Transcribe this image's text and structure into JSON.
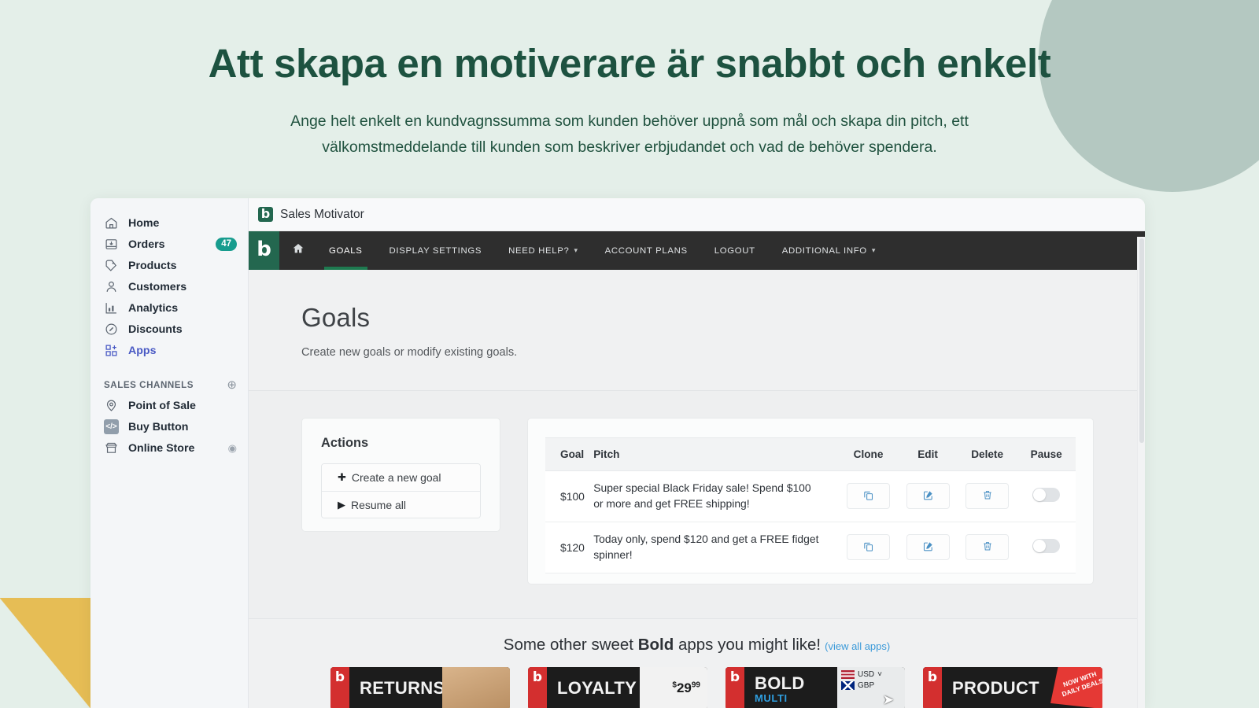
{
  "hero": {
    "title": "Att skapa en motiverare är snabbt och enkelt",
    "subtitle": "Ange helt enkelt en kundvagnssumma som kunden behöver uppnå som mål och skapa din pitch, ett välkomstmeddelande till kunden som beskriver erbjudandet och vad de behöver spendera."
  },
  "colors": {
    "page_bg": "#e4efe9",
    "deco_circle": "#b4c8c1",
    "deco_triangle": "#e6bd55",
    "heading": "#1d5240",
    "brand_green": "#23674f",
    "nav_dark": "#2e2e2e",
    "active_underline": "#1e7a50",
    "badge_teal": "#179c8e",
    "apps_link_blue": "#4959c4",
    "icon_blue": "#4a90c4",
    "promo_link": "#3b9ad9"
  },
  "sidebar": {
    "items": [
      {
        "label": "Home",
        "icon": "home-icon",
        "badge": "",
        "trailing": ""
      },
      {
        "label": "Orders",
        "icon": "orders-inbox-icon",
        "badge": "47",
        "trailing": ""
      },
      {
        "label": "Products",
        "icon": "product-tag-icon",
        "badge": "",
        "trailing": ""
      },
      {
        "label": "Customers",
        "icon": "customer-person-icon",
        "badge": "",
        "trailing": ""
      },
      {
        "label": "Analytics",
        "icon": "analytics-bars-icon",
        "badge": "",
        "trailing": ""
      },
      {
        "label": "Discounts",
        "icon": "discount-percent-icon",
        "badge": "",
        "trailing": ""
      },
      {
        "label": "Apps",
        "icon": "apps-grid-plus-icon",
        "badge": "",
        "trailing": "",
        "active": true
      }
    ],
    "section": {
      "label": "SALES CHANNELS",
      "add_icon": "plus-circle-icon"
    },
    "channels": [
      {
        "label": "Point of Sale",
        "icon": "location-pin-icon",
        "trailing": ""
      },
      {
        "label": "Buy Button",
        "icon": "code-embed-icon",
        "trailing": ""
      },
      {
        "label": "Online Store",
        "icon": "storefront-icon",
        "trailing": "view-eye-icon"
      }
    ]
  },
  "app": {
    "titlebar": {
      "logo": "bold-b-logo",
      "title": "Sales Motivator"
    },
    "nav": {
      "logo": "bold-b-logo",
      "items": [
        {
          "label": "",
          "icon": "home-icon",
          "caret": false,
          "active": false
        },
        {
          "label": "GOALS",
          "icon": "",
          "caret": false,
          "active": true
        },
        {
          "label": "DISPLAY SETTINGS",
          "icon": "",
          "caret": false,
          "active": false
        },
        {
          "label": "NEED HELP?",
          "icon": "",
          "caret": true,
          "active": false
        },
        {
          "label": "ACCOUNT PLANS",
          "icon": "",
          "caret": false,
          "active": false
        },
        {
          "label": "LOGOUT",
          "icon": "",
          "caret": false,
          "active": false
        },
        {
          "label": "ADDITIONAL INFO",
          "icon": "",
          "caret": true,
          "active": false
        }
      ]
    },
    "page": {
      "title": "Goals",
      "subtitle": "Create new goals or modify existing goals."
    },
    "actions": {
      "title": "Actions",
      "items": [
        {
          "label": "Create a new goal",
          "glyph": "✚",
          "icon": "plus-icon"
        },
        {
          "label": "Resume all",
          "glyph": "▶",
          "icon": "play-icon"
        }
      ]
    },
    "table": {
      "columns": [
        "Goal",
        "Pitch",
        "Clone",
        "Edit",
        "Delete",
        "Pause"
      ],
      "rows": [
        {
          "goal": "$100",
          "pitch": "Super special Black Friday sale! Spend $100 or more and get FREE shipping!",
          "clone_icon": "copy-icon",
          "edit_icon": "pencil-square-icon",
          "delete_icon": "trash-icon",
          "pause_state": "off"
        },
        {
          "goal": "$120",
          "pitch": "Today only, spend $120 and get a FREE fidget spinner!",
          "clone_icon": "copy-icon",
          "edit_icon": "pencil-square-icon",
          "delete_icon": "trash-icon",
          "pause_state": "off"
        }
      ]
    },
    "promo": {
      "heading_before": "Some other sweet ",
      "heading_bold": "Bold",
      "heading_after": " apps you might like!",
      "link": "(view all apps)",
      "cards": [
        {
          "word": "RETURNS",
          "sub": "",
          "art": "box-image",
          "price": "",
          "badge": ""
        },
        {
          "word": "LOYALTY",
          "sub": "",
          "art": "price-tag",
          "price": "29",
          "price_cents": "99",
          "badge": ""
        },
        {
          "word": "BOLD",
          "sub": "MULTI",
          "art": "currency-flags",
          "usd": "USD",
          "gbp": "GBP",
          "badge": ""
        },
        {
          "word": "PRODUCT",
          "sub": "",
          "art": "red-starburst",
          "badge": "NOW WITH DAILY DEALS"
        }
      ]
    }
  }
}
